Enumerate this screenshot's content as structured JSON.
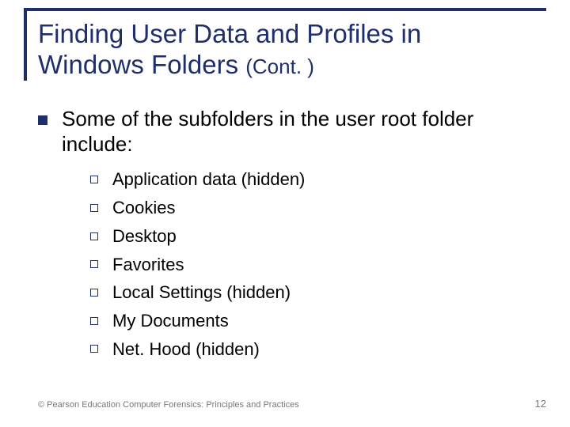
{
  "title_line1": "Finding User Data and Profiles in",
  "title_line2_a": "Windows Folders ",
  "title_line2_b": "(Cont. )",
  "bullets": {
    "lvl1": "Some of the subfolders in the user root folder include:",
    "lvl2": [
      "Application data (hidden)",
      "Cookies",
      "Desktop",
      "Favorites",
      "Local Settings (hidden)",
      "My Documents",
      "Net. Hood (hidden)"
    ]
  },
  "footer": {
    "copyright": "© Pearson Education  Computer Forensics: Principles and Practices",
    "page_number": "12"
  }
}
